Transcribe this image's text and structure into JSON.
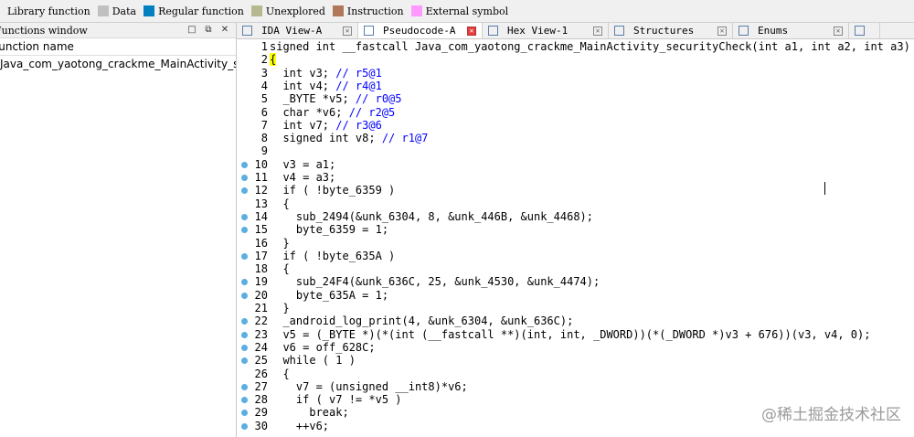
{
  "legend": [
    {
      "label": "Library function",
      "color": null
    },
    {
      "label": "Data",
      "color": "#c0c0c0"
    },
    {
      "label": "Regular function",
      "color": "#0080c0"
    },
    {
      "label": "Unexplored",
      "color": "#b8b890"
    },
    {
      "label": "Instruction",
      "color": "#b07858"
    },
    {
      "label": "External symbol",
      "color": "#ff99ff"
    }
  ],
  "functions_window": {
    "title": "Functions window",
    "column_header": "Function name",
    "rows": [
      "Java_com_yaotong_crackme_MainActivity_securityCheck"
    ]
  },
  "tabs": [
    {
      "label": "IDA View-A",
      "active": false
    },
    {
      "label": "Pseudocode-A",
      "active": true
    },
    {
      "label": "Hex View-1",
      "active": false
    },
    {
      "label": "Structures",
      "active": false
    },
    {
      "label": "Enums",
      "active": false
    }
  ],
  "code_lines": [
    {
      "n": "1",
      "dot": false,
      "text": "signed int __fastcall Java_com_yaotong_crackme_MainActivity_securityCheck(int a1, int a2, int a3)"
    },
    {
      "n": "2",
      "dot": false,
      "text": "{"
    },
    {
      "n": "3",
      "dot": false,
      "text": "  int v3; // r5@1"
    },
    {
      "n": "4",
      "dot": false,
      "text": "  int v4; // r4@1"
    },
    {
      "n": "5",
      "dot": false,
      "text": "  _BYTE *v5; // r0@5"
    },
    {
      "n": "6",
      "dot": false,
      "text": "  char *v6; // r2@5"
    },
    {
      "n": "7",
      "dot": false,
      "text": "  int v7; // r3@6"
    },
    {
      "n": "8",
      "dot": false,
      "text": "  signed int v8; // r1@7"
    },
    {
      "n": "9",
      "dot": false,
      "text": ""
    },
    {
      "n": "10",
      "dot": true,
      "text": "  v3 = a1;"
    },
    {
      "n": "11",
      "dot": true,
      "text": "  v4 = a3;"
    },
    {
      "n": "12",
      "dot": true,
      "text": "  if ( !byte_6359 )"
    },
    {
      "n": "13",
      "dot": false,
      "text": "  {"
    },
    {
      "n": "14",
      "dot": true,
      "text": "    sub_2494(&unk_6304, 8, &unk_446B, &unk_4468);"
    },
    {
      "n": "15",
      "dot": true,
      "text": "    byte_6359 = 1;"
    },
    {
      "n": "16",
      "dot": false,
      "text": "  }"
    },
    {
      "n": "17",
      "dot": true,
      "text": "  if ( !byte_635A )"
    },
    {
      "n": "18",
      "dot": false,
      "text": "  {"
    },
    {
      "n": "19",
      "dot": true,
      "text": "    sub_24F4(&unk_636C, 25, &unk_4530, &unk_4474);"
    },
    {
      "n": "20",
      "dot": true,
      "text": "    byte_635A = 1;"
    },
    {
      "n": "21",
      "dot": false,
      "text": "  }"
    },
    {
      "n": "22",
      "dot": true,
      "text": "  _android_log_print(4, &unk_6304, &unk_636C);"
    },
    {
      "n": "23",
      "dot": true,
      "text": "  v5 = (_BYTE *)(*(int (__fastcall **)(int, int, _DWORD))(*(_DWORD *)v3 + 676))(v3, v4, 0);"
    },
    {
      "n": "24",
      "dot": true,
      "text": "  v6 = off_628C;"
    },
    {
      "n": "25",
      "dot": true,
      "text": "  while ( 1 )"
    },
    {
      "n": "26",
      "dot": false,
      "text": "  {"
    },
    {
      "n": "27",
      "dot": true,
      "text": "    v7 = (unsigned __int8)*v6;"
    },
    {
      "n": "28",
      "dot": true,
      "text": "    if ( v7 != *v5 )"
    },
    {
      "n": "29",
      "dot": true,
      "text": "      break;"
    },
    {
      "n": "30",
      "dot": true,
      "text": "    ++v6;"
    }
  ],
  "watermark": "@稀土掘金技术社区"
}
